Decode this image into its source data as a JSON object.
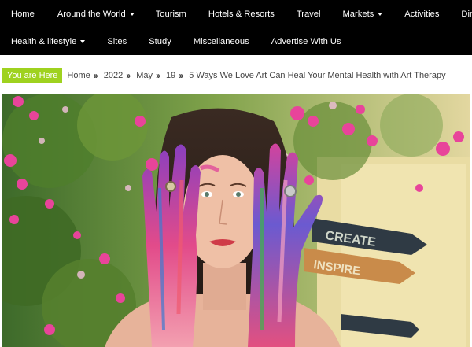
{
  "nav": {
    "row1": [
      {
        "label": "Home",
        "dropdown": false
      },
      {
        "label": "Around the World",
        "dropdown": true
      },
      {
        "label": "Tourism",
        "dropdown": false
      },
      {
        "label": "Hotels & Resorts",
        "dropdown": false
      },
      {
        "label": "Travel",
        "dropdown": false
      },
      {
        "label": "Markets",
        "dropdown": true
      },
      {
        "label": "Activities",
        "dropdown": false
      },
      {
        "label": "Dining",
        "dropdown": false
      }
    ],
    "row2": [
      {
        "label": "Health & lifestyle",
        "dropdown": true
      },
      {
        "label": "Sites",
        "dropdown": false
      },
      {
        "label": "Study",
        "dropdown": false
      },
      {
        "label": "Miscellaneous",
        "dropdown": false
      },
      {
        "label": "Advertise With Us",
        "dropdown": false
      }
    ]
  },
  "breadcrumb": {
    "badge": "You are Here",
    "items": [
      "Home",
      "2022",
      "May",
      "19",
      "5 Ways We Love Art Can Heal Your Mental Health with Art Therapy"
    ]
  },
  "hero": {
    "signs": [
      "CREATE",
      "INSPIRE"
    ],
    "colors": {
      "accent": "#9fd21f",
      "nav_bg": "#000000"
    }
  }
}
